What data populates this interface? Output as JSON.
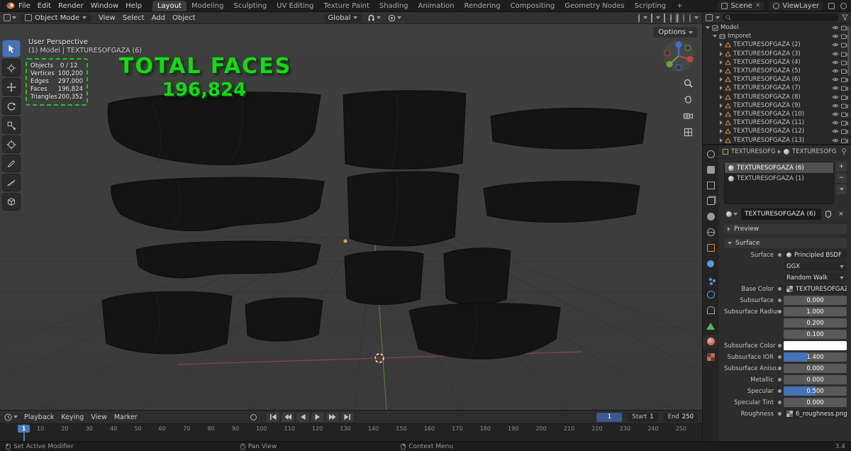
{
  "topbar": {
    "menus": [
      "File",
      "Edit",
      "Render",
      "Window",
      "Help"
    ],
    "workspaces": [
      "Layout",
      "Modeling",
      "Sculpting",
      "UV Editing",
      "Texture Paint",
      "Shading",
      "Animation",
      "Rendering",
      "Compositing",
      "Geometry Nodes",
      "Scripting"
    ],
    "add_workspace": "+",
    "scene": "Scene",
    "view_layer": "ViewLayer"
  },
  "viewport_header": {
    "mode": "Object Mode",
    "menus": [
      "View",
      "Select",
      "Add",
      "Object"
    ],
    "orientation": "Global",
    "options": "Options"
  },
  "viewport": {
    "perspective": "User Perspective",
    "context": "(1) Model | TEXTURESOFGAZA (6)",
    "overlay_title": "TOTAL FACES",
    "overlay_value": "196,824",
    "stats": [
      {
        "label": "Objects",
        "value": "0 / 12"
      },
      {
        "label": "Vertices",
        "value": "100,200"
      },
      {
        "label": "Edges",
        "value": "297,000"
      },
      {
        "label": "Faces",
        "value": "196,824"
      },
      {
        "label": "Triangles",
        "value": "200,352"
      }
    ]
  },
  "outliner": {
    "root": "Model",
    "collection": "Imporet",
    "items": [
      "TEXTURESOFGAZA (2)",
      "TEXTURESOFGAZA (3)",
      "TEXTURESOFGAZA (4)",
      "TEXTURESOFGAZA (5)",
      "TEXTURESOFGAZA (6)",
      "TEXTURESOFGAZA (7)",
      "TEXTURESOFGAZA (8)",
      "TEXTURESOFGAZA (9)",
      "TEXTURESOFGAZA (10)",
      "TEXTURESOFGAZA (11)",
      "TEXTURESOFGAZA (12)",
      "TEXTURESOFGAZA (13)"
    ]
  },
  "properties": {
    "breadcrumb_object": "TEXTURESOFG...",
    "breadcrumb_material": "TEXTURESOFG...",
    "slots": [
      "TEXTURESOFGAZA (6)",
      "TEXTURESOFGAZA (1)"
    ],
    "material_name": "TEXTURESOFGAZA (6)",
    "preview_section": "Preview",
    "surface_section": "Surface",
    "surface_label": "Surface",
    "surface_value": "Principled BSDF",
    "distribution": "GGX",
    "subsurface_method": "Random Walk",
    "base_color_label": "Base Color",
    "base_color_value": "TEXTURESOFGAZA (6)...",
    "fields": [
      {
        "label": "Subsurface",
        "value": "0.000"
      },
      {
        "label": "Subsurface Radius",
        "value": "1.000"
      },
      {
        "label": "",
        "value": "0.200"
      },
      {
        "label": "",
        "value": "0.100"
      },
      {
        "label": "Subsurface Color",
        "value": ""
      },
      {
        "label": "Subsurface IOR",
        "value": "1.400"
      },
      {
        "label": "Subsurface Aniso...",
        "value": "0.000"
      },
      {
        "label": "Metallic",
        "value": "0.000"
      },
      {
        "label": "Specular",
        "value": "0.500"
      },
      {
        "label": "Specular Tint",
        "value": "0.000"
      },
      {
        "label": "Roughness",
        "value": "6_roughness.png"
      }
    ]
  },
  "timeline": {
    "menus": [
      "Playback",
      "Keying",
      "View",
      "Marker"
    ],
    "current_frame": "1",
    "start_label": "Start",
    "start_value": "1",
    "end_label": "End",
    "end_value": "250",
    "ticks": [
      "10",
      "20",
      "30",
      "40",
      "50",
      "60",
      "70",
      "80",
      "90",
      "100",
      "110",
      "120",
      "130",
      "140",
      "150",
      "160",
      "170",
      "180",
      "190",
      "200",
      "210",
      "220",
      "230",
      "240",
      "250"
    ]
  },
  "statusbar": {
    "set_active": "Set Active Modifier",
    "pan": "Pan View",
    "context_menu": "Context Menu",
    "version": "3.4"
  },
  "colors": {
    "accent_blue": "#4772b3",
    "overlay_green": "#16d916",
    "object_orange": "#e8883d"
  }
}
